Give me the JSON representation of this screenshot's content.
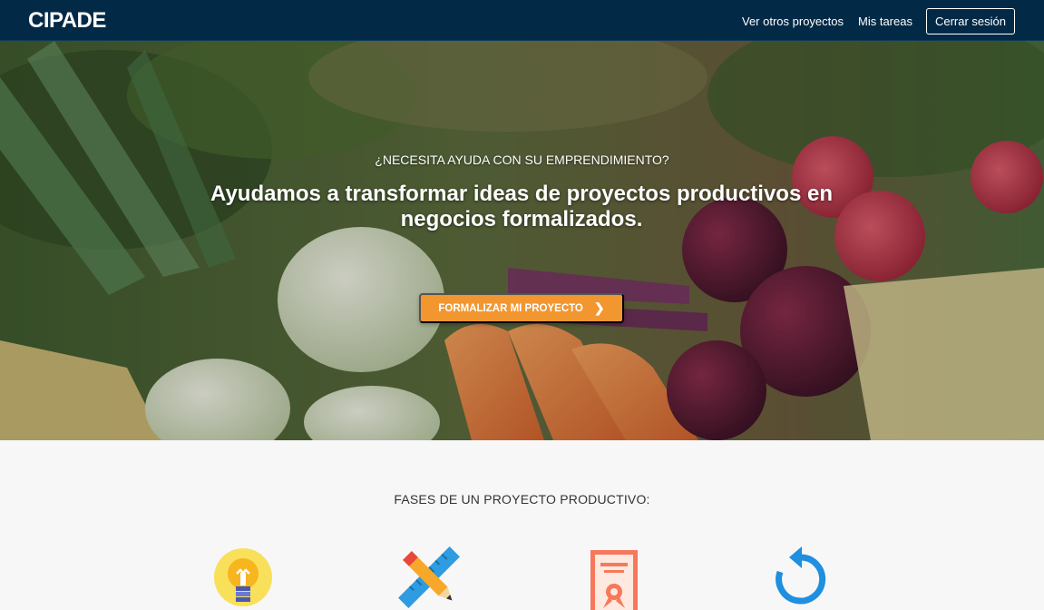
{
  "navbar": {
    "brand": "CIPADE",
    "links": [
      "Ver otros proyectos",
      "Mis tareas"
    ],
    "logout_label": "Cerrar sesión"
  },
  "hero": {
    "kicker": "¿NECESITA AYUDA CON SU EMPRENDIMIENTO?",
    "title": "Ayudamos a transformar ideas de proyectos productivos en negocios formalizados.",
    "cta_label": "FORMALIZAR MI PROYECTO",
    "cta_icon": "chevron-right-icon"
  },
  "phases": {
    "title": "FASES DE UN PROYECTO PRODUCTIVO:",
    "icons": [
      "lightbulb-icon",
      "ruler-pencil-icon",
      "certificate-icon",
      "refresh-icon"
    ]
  },
  "colors": {
    "navbar": "#022a47",
    "cta": "#f2962f",
    "section_bg": "#f7f7f7"
  }
}
